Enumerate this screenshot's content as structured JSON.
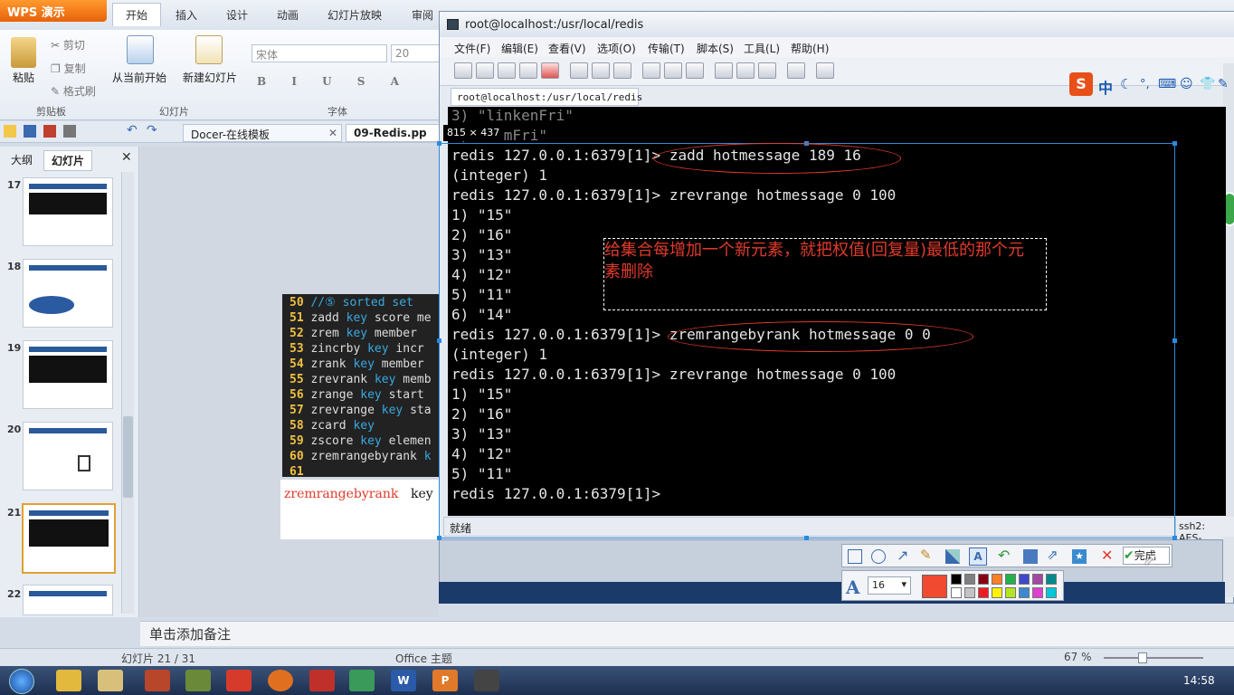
{
  "wps": {
    "logo": "WPS 演示",
    "tabs": [
      "开始",
      "插入",
      "设计",
      "动画",
      "幻灯片放映",
      "审阅"
    ],
    "clipboard": {
      "paste": "粘贴",
      "cut": "剪切",
      "copy": "复制",
      "format": "格式刷",
      "group": "剪贴板"
    },
    "slides_group": {
      "from_current": "从当前开始",
      "new_slide": "新建幻灯片",
      "group": "幻灯片"
    },
    "font": {
      "name": "宋体",
      "size": "20",
      "group": "字体"
    },
    "doc_tabs": [
      "Docer-在线模板",
      "09-Redis.pp"
    ],
    "left_tabs": {
      "outline": "大纲",
      "slides": "幻灯片"
    },
    "thumbs": [
      "17",
      "18",
      "19",
      "20",
      "21",
      "22"
    ],
    "code_lines": [
      {
        "n": "50",
        "pre": "//⑤ sorted set",
        "kw": "",
        "post": ""
      },
      {
        "n": "51",
        "pre": "zadd ",
        "kw": "key",
        "post": " score me"
      },
      {
        "n": "52",
        "pre": "zrem ",
        "kw": "key",
        "post": " member"
      },
      {
        "n": "53",
        "pre": "zincrby ",
        "kw": "key",
        "post": " incr"
      },
      {
        "n": "54",
        "pre": "zrank ",
        "kw": "key",
        "post": " member"
      },
      {
        "n": "55",
        "pre": "zrevrank ",
        "kw": "key",
        "post": " memb"
      },
      {
        "n": "56",
        "pre": "zrange ",
        "kw": "key",
        "post": " start"
      },
      {
        "n": "57",
        "pre": "zrevrange ",
        "kw": "key",
        "post": " sta"
      },
      {
        "n": "58",
        "pre": "zcard ",
        "kw": "key",
        "post": ""
      },
      {
        "n": "59",
        "pre": "zscore ",
        "kw": "key",
        "post": " elemen"
      },
      {
        "n": "60",
        "pre": "zremrangebyrank ",
        "kw": "k",
        "post": ""
      },
      {
        "n": "61",
        "pre": "",
        "kw": "",
        "post": ""
      }
    ],
    "slide_caption": {
      "cmd": "zremrangebyrank",
      "arg": "key"
    },
    "notes": "单击添加备注",
    "status_slide": "幻灯片 21 / 31",
    "status_theme": "Office 主题",
    "zoom": "67 %",
    "clock": "14:58"
  },
  "terminal": {
    "title": "root@localhost:/usr/local/redis",
    "menu": [
      "文件(F)",
      "编辑(E)",
      "查看(V)",
      "选项(O)",
      "传输(T)",
      "脚本(S)",
      "工具(L)",
      "帮助(H)"
    ],
    "tab": "root@localhost:/usr/local/redis",
    "lines": [
      "3) \"linkenFri\"",
      "4) \"tomFri\"",
      "redis 127.0.0.1:6379[1]> zadd hotmessage 189 16",
      "(integer) 1",
      "redis 127.0.0.1:6379[1]> zrevrange hotmessage 0 100",
      "1) \"15\"",
      "2) \"16\"",
      "3) \"13\"",
      "4) \"12\"",
      "5) \"11\"",
      "6) \"14\"",
      "redis 127.0.0.1:6379[1]> zremrangebyrank hotmessage 0 0",
      "(integer) 1",
      "redis 127.0.0.1:6379[1]> zrevrange hotmessage 0 100",
      "1) \"15\"",
      "2) \"16\"",
      "3) \"13\"",
      "4) \"12\"",
      "5) \"11\"",
      "redis 127.0.0.1:6379[1]>"
    ],
    "status": "就绪",
    "ssh": "ssh2: AES-"
  },
  "snip": {
    "size": "815 × 437",
    "annotation": "给集合每增加一个新元素，就把权值(回复量)最低的那个元素删除",
    "done": "完成",
    "font_size": "16",
    "colors": [
      "#000000",
      "#7f7f7f",
      "#880015",
      "#ed1c24",
      "#ff7f27",
      "#22b14c",
      "#3f48cc",
      "#a349a4",
      "#00a2e8",
      "#ffffff",
      "#c3c3c3",
      "#b97a57",
      "#ffaec9",
      "#fff200",
      "#b5e61d",
      "#99d9ea",
      "#7092be",
      "#c8bfe7"
    ]
  },
  "ime": {
    "lang": "中"
  }
}
